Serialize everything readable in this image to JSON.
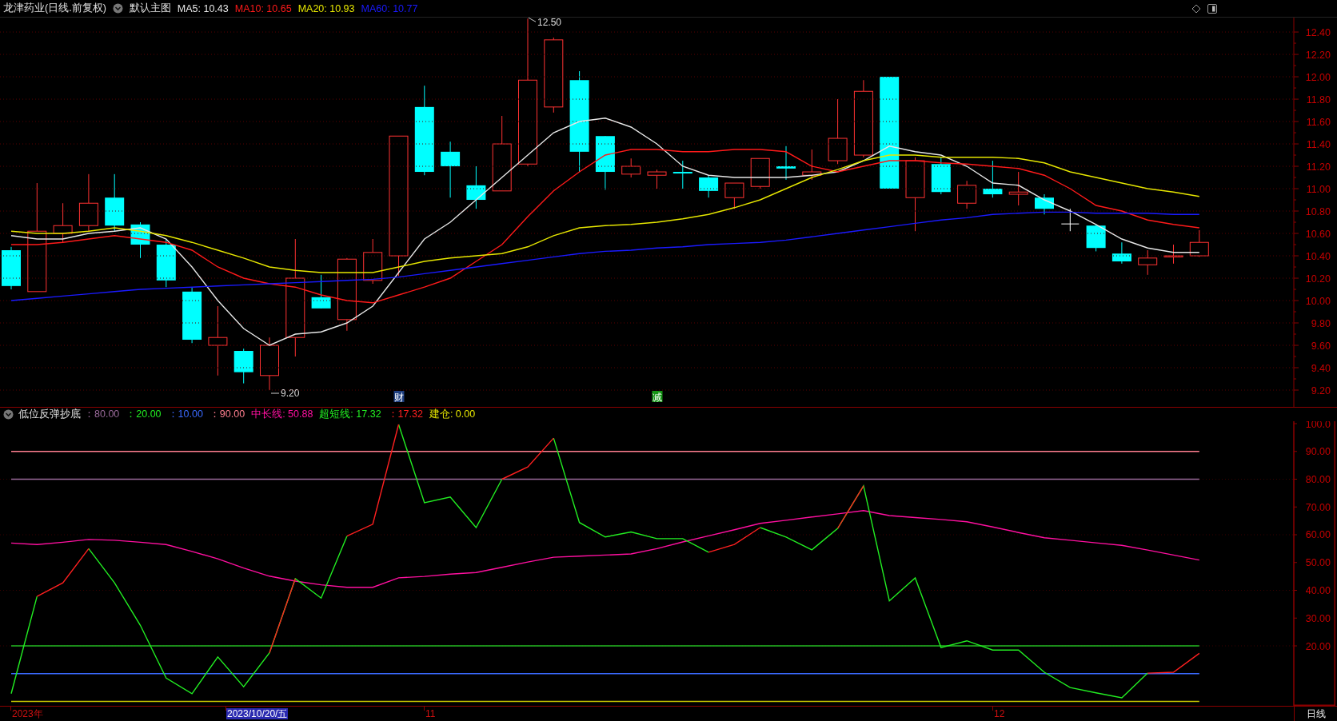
{
  "header": {
    "title": "龙津药业(日线.前复权)",
    "template": "默认主图",
    "indicators": [
      {
        "value": ": 10.43"
      },
      {
        "value": ": 10.65"
      },
      {
        "value": ": 10.93"
      },
      {
        "value": ": 10.77"
      }
    ]
  },
  "price_chart": {
    "chart_data": {
      "type": "line",
      "grid": true,
      "ylim": [
        9.05,
        12.529
      ],
      "yticks": [
        {
          "value": 9.2,
          "label": "9.20"
        },
        {
          "value": 9.4,
          "label": "9.40"
        },
        {
          "value": 9.6,
          "label": "9.60"
        },
        {
          "value": 9.8,
          "label": "9.80"
        },
        {
          "value": 10.0,
          "label": "10.00"
        },
        {
          "value": 10.2,
          "label": "10.20"
        },
        {
          "value": 10.4,
          "label": "10.40"
        },
        {
          "value": 10.6,
          "label": "10.60"
        },
        {
          "value": 10.8,
          "label": "10.80"
        },
        {
          "value": 11.0,
          "label": "11.00"
        },
        {
          "value": 11.2,
          "label": "11.20"
        },
        {
          "value": 11.4,
          "label": "11.40"
        },
        {
          "value": 11.6,
          "label": "11.60"
        },
        {
          "value": 11.8,
          "label": "11.80"
        },
        {
          "value": 12.0,
          "label": "12.00"
        },
        {
          "value": 12.2,
          "label": "12.20"
        },
        {
          "value": 12.4,
          "label": "12.40"
        }
      ],
      "series": [
        {
          "name": "MA5",
          "color": "#e6e6e6",
          "values": [
            10.58,
            10.55,
            10.55,
            10.6,
            10.62,
            10.65,
            10.55,
            10.3,
            10.0,
            9.75,
            9.6,
            9.7,
            9.72,
            9.8,
            9.95,
            10.25,
            10.55,
            10.7,
            10.9,
            11.1,
            11.3,
            11.5,
            11.6,
            11.63,
            11.55,
            11.4,
            11.2,
            11.12,
            11.1,
            11.1,
            11.1,
            11.12,
            11.15,
            11.25,
            11.38,
            11.33,
            11.3,
            11.2,
            11.05,
            11.03,
            10.9,
            10.8,
            10.68,
            10.55,
            10.47,
            10.43,
            10.43
          ]
        },
        {
          "name": "MA10",
          "color": "#ff1a1a",
          "values": [
            10.5,
            10.5,
            10.52,
            10.55,
            10.58,
            10.55,
            10.52,
            10.45,
            10.3,
            10.2,
            10.15,
            10.12,
            10.05,
            10.0,
            9.98,
            10.05,
            10.12,
            10.2,
            10.35,
            10.5,
            10.75,
            10.98,
            11.15,
            11.3,
            11.35,
            11.35,
            11.33,
            11.33,
            11.35,
            11.35,
            11.33,
            11.2,
            11.15,
            11.2,
            11.25,
            11.25,
            11.23,
            11.22,
            11.2,
            11.18,
            11.12,
            11.0,
            10.85,
            10.8,
            10.72,
            10.68,
            10.65
          ]
        },
        {
          "name": "MA20",
          "color": "#e6e600",
          "values": [
            10.62,
            10.6,
            10.6,
            10.62,
            10.65,
            10.62,
            10.58,
            10.52,
            10.45,
            10.38,
            10.3,
            10.27,
            10.25,
            10.25,
            10.25,
            10.3,
            10.35,
            10.38,
            10.4,
            10.42,
            10.48,
            10.58,
            10.65,
            10.67,
            10.68,
            10.7,
            10.73,
            10.77,
            10.83,
            10.9,
            11.0,
            11.1,
            11.17,
            11.25,
            11.3,
            11.3,
            11.28,
            11.28,
            11.28,
            11.27,
            11.23,
            11.15,
            11.1,
            11.05,
            11.0,
            10.97,
            10.93
          ]
        },
        {
          "name": "MA60",
          "color": "#1a1aff",
          "values": [
            10.0,
            10.02,
            10.04,
            10.06,
            10.08,
            10.1,
            10.11,
            10.12,
            10.13,
            10.14,
            10.15,
            10.16,
            10.17,
            10.18,
            10.19,
            10.21,
            10.24,
            10.27,
            10.3,
            10.33,
            10.36,
            10.39,
            10.42,
            10.44,
            10.45,
            10.47,
            10.48,
            10.5,
            10.51,
            10.52,
            10.54,
            10.57,
            10.6,
            10.63,
            10.66,
            10.69,
            10.72,
            10.74,
            10.77,
            10.78,
            10.79,
            10.79,
            10.78,
            10.78,
            10.78,
            10.77,
            10.77
          ]
        }
      ]
    },
    "markers": [
      {
        "kind": "high",
        "label": "12.50"
      },
      {
        "kind": "low",
        "label": "9.20"
      }
    ],
    "events": [
      {
        "label": "财",
        "color": "#1f3f80"
      },
      {
        "label": "减",
        "color": "#149414"
      }
    ]
  },
  "indicator_chart": {
    "name": "低位反弹抄底",
    "params": [
      {
        "kind": "text",
        "label": "：80.00",
        "color": "#9a6a9a"
      },
      {
        "kind": "text",
        "label": "：20.00",
        "color": "#22ee22"
      },
      {
        "kind": "text",
        "label": "：10.00",
        "color": "#3a6aff"
      },
      {
        "kind": "text",
        "label": "：90.00",
        "color": "#ff7f8f"
      },
      {
        "kind": "series",
        "value": ": 50.88"
      },
      {
        "kind": "series",
        "value": ": 17.32"
      },
      {
        "kind": "text",
        "label": "：17.32",
        "color": "#ff2020"
      },
      {
        "kind": "text",
        "label": "建仓: 0.00",
        "color": "#e6e600"
      }
    ],
    "chart_data": {
      "type": "line",
      "grid": true,
      "ylim": [
        -1.58,
        100.86
      ],
      "yticks": [
        {
          "value": 20,
          "label": "20.00"
        },
        {
          "value": 30,
          "label": "30.00"
        },
        {
          "value": 40,
          "label": "40.00"
        },
        {
          "value": 50,
          "label": "50.00"
        },
        {
          "value": 60,
          "label": "60.00"
        },
        {
          "value": 70,
          "label": "70.00"
        },
        {
          "value": 80,
          "label": "80.00"
        },
        {
          "value": 90,
          "label": "90.00"
        },
        {
          "value": 100,
          "label": "100.0"
        }
      ],
      "series": [
        {
          "color": "#ff7f8f",
          "values": [
            90,
            90,
            90,
            90,
            90,
            90,
            90,
            90,
            90,
            90,
            90,
            90,
            90,
            90,
            90,
            90,
            90,
            90,
            90,
            90,
            90,
            90,
            90,
            90,
            90,
            90,
            90,
            90,
            90,
            90,
            90,
            90,
            90,
            90,
            90,
            90,
            90,
            90,
            90,
            90,
            90,
            90,
            90,
            90,
            90,
            90,
            90
          ]
        },
        {
          "color": "#9a6a9a",
          "values": [
            80,
            80,
            80,
            80,
            80,
            80,
            80,
            80,
            80,
            80,
            80,
            80,
            80,
            80,
            80,
            80,
            80,
            80,
            80,
            80,
            80,
            80,
            80,
            80,
            80,
            80,
            80,
            80,
            80,
            80,
            80,
            80,
            80,
            80,
            80,
            80,
            80,
            80,
            80,
            80,
            80,
            80,
            80,
            80,
            80,
            80,
            80
          ]
        },
        {
          "color": "#22bb22",
          "values": [
            20,
            20,
            20,
            20,
            20,
            20,
            20,
            20,
            20,
            20,
            20,
            20,
            20,
            20,
            20,
            20,
            20,
            20,
            20,
            20,
            20,
            20,
            20,
            20,
            20,
            20,
            20,
            20,
            20,
            20,
            20,
            20,
            20,
            20,
            20,
            20,
            20,
            20,
            20,
            20,
            20,
            20,
            20,
            20,
            20,
            20,
            20
          ]
        },
        {
          "color": "#3a6aff",
          "values": [
            10,
            10,
            10,
            10,
            10,
            10,
            10,
            10,
            10,
            10,
            10,
            10,
            10,
            10,
            10,
            10,
            10,
            10,
            10,
            10,
            10,
            10,
            10,
            10,
            10,
            10,
            10,
            10,
            10,
            10,
            10,
            10,
            10,
            10,
            10,
            10,
            10,
            10,
            10,
            10,
            10,
            10,
            10,
            10,
            10,
            10,
            10
          ]
        },
        {
          "color": "#c8c800",
          "values": [
            0,
            0,
            0,
            0,
            0,
            0,
            0,
            0,
            0,
            0,
            0,
            0,
            0,
            0,
            0,
            0,
            0,
            0,
            0,
            0,
            0,
            0,
            0,
            0,
            0,
            0,
            0,
            0,
            0,
            0,
            0,
            0,
            0,
            0,
            0,
            0,
            0,
            0,
            0,
            0,
            0,
            0,
            0,
            0,
            0,
            0,
            0
          ]
        },
        {
          "name": "中长线",
          "color": "#ff10a0",
          "values": [
            57,
            56.5,
            57.3,
            58.3,
            58,
            57.3,
            56.5,
            54,
            51.3,
            48,
            45.1,
            43.3,
            42,
            41.1,
            41.1,
            44.5,
            45,
            45.8,
            46.4,
            48.3,
            50.2,
            51.9,
            52.3,
            52.7,
            53.1,
            55,
            57.4,
            59.6,
            61.8,
            64.1,
            65.2,
            66.4,
            67.5,
            68.7,
            66.9,
            66.2,
            65.5,
            64.7,
            62.8,
            60.8,
            58.9,
            58,
            57.1,
            56.2,
            54.5,
            52.7,
            50.9
          ]
        },
        {
          "name": "超短线",
          "color": "#22ee22",
          "values": [
            2.8,
            37.8,
            null,
            55,
            42.7,
            27.4,
            8.4,
            2.8,
            16,
            5.3,
            17.5,
            44.2,
            37.2,
            59.5,
            null,
            99.7,
            71.5,
            73.6,
            62.6,
            80,
            null,
            94.8,
            64.4,
            59.2,
            61,
            58.6,
            58.6,
            53.7,
            null,
            62.6,
            59.2,
            54.6,
            62.3,
            77.6,
            36.2,
            44.5,
            19.4,
            21.8,
            18.5,
            18.5,
            10.5,
            5,
            3.1,
            1.3,
            10.2,
            null,
            null
          ]
        },
        {
          "color": "#ff2020",
          "values": [
            null,
            37.8,
            42.7,
            55,
            null,
            null,
            null,
            null,
            null,
            null,
            17.5,
            44.2,
            null,
            59.5,
            63.8,
            99.7,
            null,
            null,
            null,
            80,
            84.4,
            94.8,
            null,
            null,
            null,
            null,
            null,
            53.7,
            56.5,
            62.6,
            null,
            null,
            62.3,
            77.6,
            null,
            null,
            null,
            null,
            null,
            null,
            null,
            null,
            null,
            null,
            10.2,
            10.5,
            17.3
          ]
        }
      ]
    }
  },
  "date_axis": {
    "labels": [
      {
        "label": "2023年",
        "selected": false
      },
      {
        "label": "2023/10/20/五",
        "selected": true
      },
      {
        "label": "11",
        "selected": false
      },
      {
        "label": "12",
        "selected": false
      }
    ],
    "period": "日线"
  }
}
